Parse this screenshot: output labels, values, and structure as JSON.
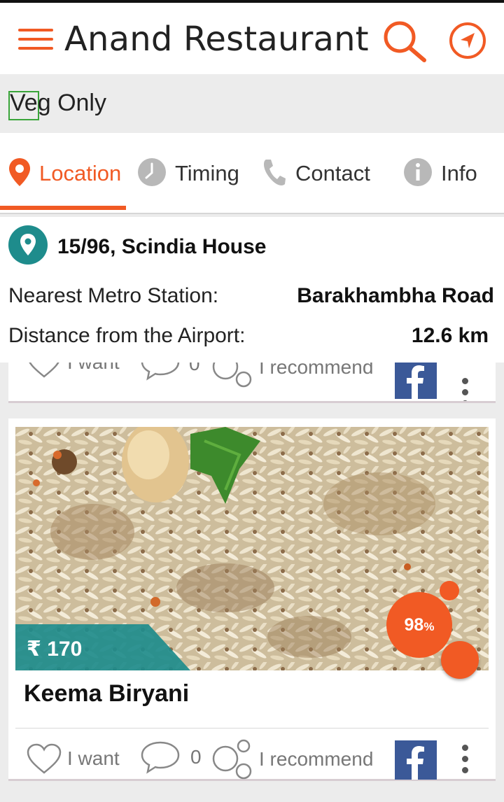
{
  "app": {
    "title": "Anand Restaurant"
  },
  "filter": {
    "veg_only_label": "Veg Only"
  },
  "tabs": [
    {
      "label": "Location",
      "icon": "location-pin-icon",
      "active": true
    },
    {
      "label": "Timing",
      "icon": "clock-icon",
      "active": false
    },
    {
      "label": "Contact",
      "icon": "phone-icon",
      "active": false
    },
    {
      "label": "Info",
      "icon": "info-icon",
      "active": false
    }
  ],
  "location": {
    "address": "15/96, Scindia House",
    "metro_label": "Nearest Metro Station:",
    "metro_value": "Barakhambha Road",
    "airport_label": "Distance from the Airport:",
    "airport_value": "12.6 km"
  },
  "actions": {
    "want_label": "I want",
    "comment_count": "0",
    "recommend_label": "I recommend"
  },
  "dish": {
    "name": "Keema Biryani",
    "price": "₹ 170",
    "rating_value": "98",
    "rating_unit": "%"
  },
  "colors": {
    "accent": "#f15a24",
    "teal": "#1e8c8c",
    "facebook": "#3b5998",
    "veg_green": "#3aa53a"
  }
}
